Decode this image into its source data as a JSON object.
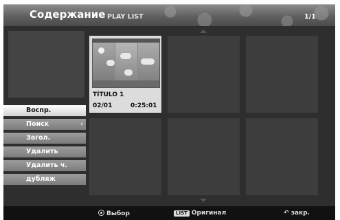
{
  "header": {
    "title": "Содержание",
    "subtitle": "PLAY LIST",
    "page_indicator": "1/1"
  },
  "menu": {
    "items": [
      {
        "label": "Воспр.",
        "selected": true
      },
      {
        "label": "Поиск",
        "has_submenu": true,
        "submenu_icon": "chevron-right-icon",
        "arrow": "›"
      },
      {
        "label": "Загол."
      },
      {
        "label": "Удалить"
      },
      {
        "label": "Удалить ч."
      },
      {
        "label": "дубляж"
      }
    ]
  },
  "grid": {
    "items": [
      {
        "title": "TÍTULO 1",
        "date": "02/01",
        "duration": "0:25:01",
        "selected": true
      }
    ]
  },
  "footer": {
    "select": {
      "icon": "ok-icon",
      "label": "Выбор"
    },
    "list": {
      "key": "LIST",
      "label": "Оригинал"
    },
    "close": {
      "icon": "return-icon",
      "label": "закр."
    }
  }
}
